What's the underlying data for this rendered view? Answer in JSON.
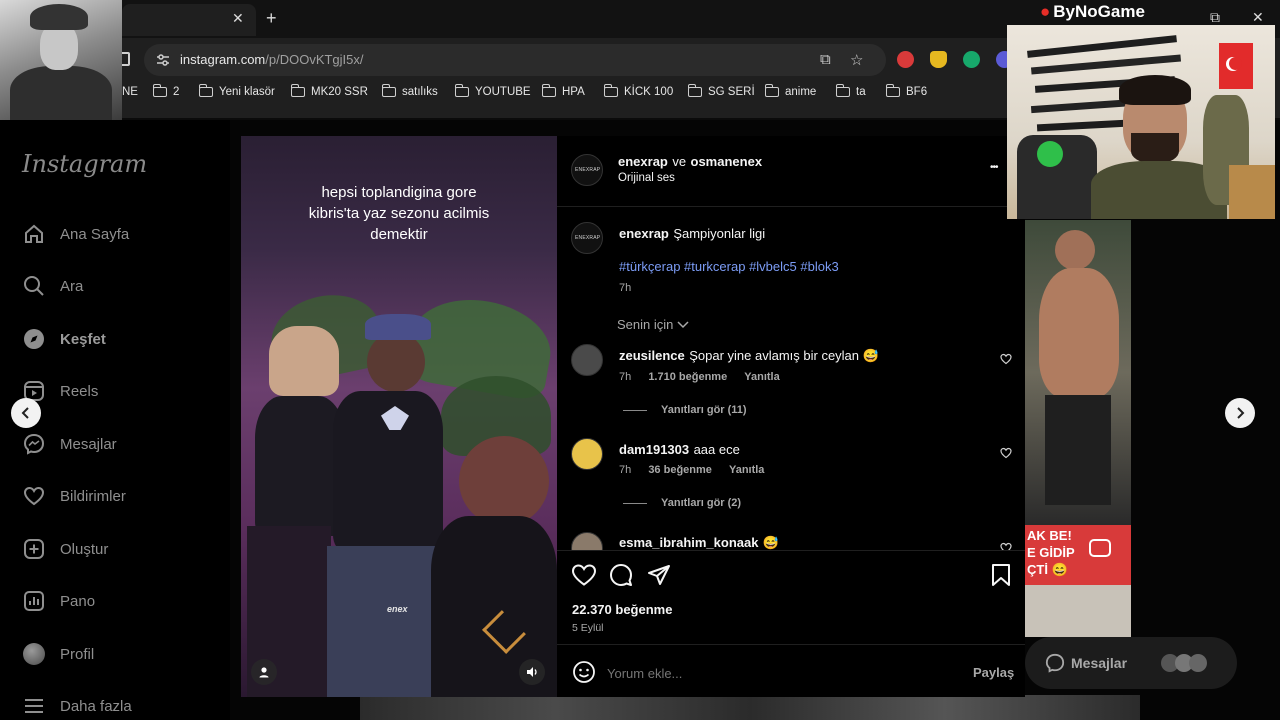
{
  "browser": {
    "url_host": "instagram.com",
    "url_path": "/p/DOOvKTgjI5x/",
    "tab_close": "✕",
    "new_tab": "+",
    "bookmarks": [
      {
        "label": "NE",
        "folder": false
      },
      {
        "label": "2",
        "folder": true
      },
      {
        "label": "Yeni klasör",
        "folder": true
      },
      {
        "label": "MK20 SSR",
        "folder": true
      },
      {
        "label": "satılıks",
        "folder": true
      },
      {
        "label": "YOUTUBE",
        "folder": true
      },
      {
        "label": "HPA",
        "folder": true
      },
      {
        "label": "KİCK 100",
        "folder": true
      },
      {
        "label": "SG SERİ",
        "folder": true
      },
      {
        "label": "anime",
        "folder": true
      },
      {
        "label": "ta",
        "folder": true
      },
      {
        "label": "BF6",
        "folder": true
      }
    ]
  },
  "overlay": {
    "brand": "ByNoGame"
  },
  "sidebar": {
    "logo": "Instagram",
    "items": [
      {
        "label": "Ana Sayfa",
        "icon": "home-icon"
      },
      {
        "label": "Ara",
        "icon": "search-icon"
      },
      {
        "label": "Keşfet",
        "icon": "compass-icon",
        "bold": true
      },
      {
        "label": "Reels",
        "icon": "reels-icon"
      },
      {
        "label": "Mesajlar",
        "icon": "messenger-icon"
      },
      {
        "label": "Bildirimler",
        "icon": "heart-icon"
      },
      {
        "label": "Oluştur",
        "icon": "plus-square-icon"
      },
      {
        "label": "Pano",
        "icon": "dashboard-icon"
      },
      {
        "label": "Profil",
        "icon": "profile-avatar"
      },
      {
        "label": "Daha fazla",
        "icon": "menu-icon"
      }
    ]
  },
  "post": {
    "media_caption": [
      "hepsi toplandigina gore",
      "kibris'ta yaz sezonu acilmis",
      "demektir"
    ],
    "media_watermark": "enex",
    "header": {
      "author": "enexrap",
      "connector": "ve",
      "coauthor": "osmanenex",
      "audio": "Orijinal ses",
      "more": "•••",
      "avatar_text": "ENEXRAP"
    },
    "caption": {
      "author": "enexrap",
      "text": "Şampiyonlar ligi",
      "hashtags": "#türkçerap #turkcerap #lvbelc5 #blok3",
      "time": "7h"
    },
    "filter_label": "Senin için",
    "comments": [
      {
        "user": "zeusilence",
        "text": "Şopar yine avlamış bir ceylan 😅",
        "time": "7h",
        "likes": "1.710 beğenme",
        "reply": "Yanıtla",
        "replies": "Yanıtları gör (11)"
      },
      {
        "user": "dam191303",
        "text": "aaa ece",
        "time": "7h",
        "likes": "36 beğenme",
        "reply": "Yanıtla",
        "replies": "Yanıtları gör (2)"
      },
      {
        "user": "esma_ibrahim_konaak",
        "text": "😅"
      }
    ],
    "likes": "22.370 beğenme",
    "date": "5 Eylül",
    "comment_placeholder": "Yorum ekle...",
    "share_label": "Paylaş"
  },
  "background": {
    "thumb_text": [
      "AK BE!",
      "E GİDİP",
      "ÇTİ 😄"
    ],
    "messages_label": "Mesajlar"
  },
  "colors": {
    "accent_link": "#7c9cf5",
    "brand_red": "#e52d27",
    "panel_bg": "#000000"
  }
}
